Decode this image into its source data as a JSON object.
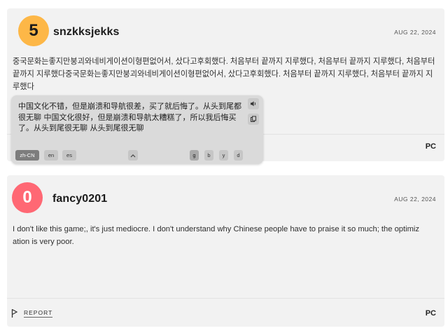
{
  "reviews": [
    {
      "score": "5",
      "score_color": "#fdb747",
      "username": "snzkksjekks",
      "date": "AUG 22, 2024",
      "text": "중국문화는좋지만붕괴와네비게이션이형편없어서, 샀다고후회했다. 처음부터 끝까지 지루했다, 처음부터 끝까지 지루했다, 처음부터 끝까지 지루했다중국문화는좋지만붕괴와네비게이션이형편없어서, 샀다고후회했다. 처음부터 끝까지 지루했다, 처음부터 끝까지 지루했다",
      "platform": "PC"
    },
    {
      "score": "0",
      "score_color": "#ff6874",
      "username": "fancy0201",
      "date": "AUG 22, 2024",
      "text": "I don't like this game;,  it's just mediocre. I don't understand why Chinese people have to praise it so much; the optimization is very poor.",
      "platform": "PC",
      "report_label": "REPORT"
    }
  ],
  "translation_popup": {
    "text": "中国文化不错，但是崩溃和导航很差，买了就后悔了。从头到尾都很无聊 中国文化很好，但是崩溃和导航太糟糕了，所以我后悔买了。从头到尾很无聊 从头到尾很无聊",
    "sound_icon": "speaker-icon",
    "copy_icon": "copy-icon",
    "languages": [
      "zh-CN",
      "en",
      "es"
    ],
    "active_language": "zh-CN",
    "engines": [
      "g",
      "b",
      "y",
      "d"
    ],
    "active_engine": "g",
    "collapse_icon": "chevron-up-icon"
  }
}
